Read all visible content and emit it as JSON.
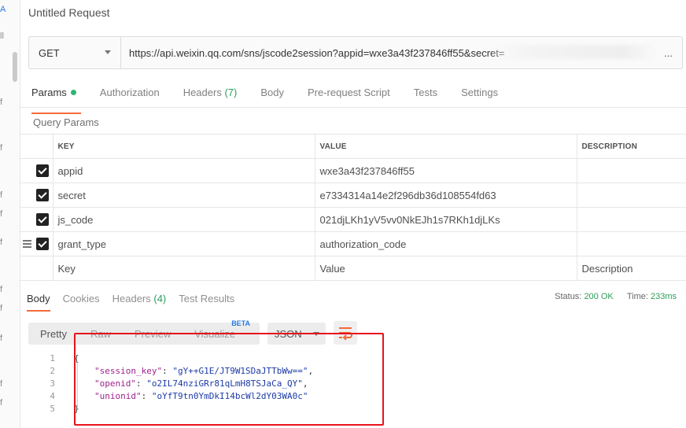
{
  "sidebar": {
    "fragments": [
      "A",
      "ll",
      "f",
      "f",
      "f",
      "f",
      "f",
      "f",
      "f",
      "f",
      "f",
      "f"
    ]
  },
  "request": {
    "title": "Untitled Request",
    "method": "GET",
    "url": "https://api.weixin.qq.com/sns/jscode2session?appid=wxe3a43f237846ff55&secret=",
    "url_overflow": "..."
  },
  "request_tabs": {
    "params": "Params",
    "authorization": "Authorization",
    "headers": "Headers",
    "headers_count": "(7)",
    "body": "Body",
    "prerequest": "Pre-request Script",
    "tests": "Tests",
    "settings": "Settings"
  },
  "query_params": {
    "label": "Query Params",
    "columns": {
      "key": "KEY",
      "value": "VALUE",
      "description": "DESCRIPTION"
    },
    "rows": [
      {
        "key": "appid",
        "value": "wxe3a43f237846ff55",
        "description": "",
        "checked": true
      },
      {
        "key": "secret",
        "value": "e7334314a14e2f296db36d108554fd63",
        "description": "",
        "checked": true
      },
      {
        "key": "js_code",
        "value": "021djLKh1yV5vv0NkEJh1s7RKh1djLKs",
        "description": "",
        "checked": true
      },
      {
        "key": "grant_type",
        "value": "authorization_code",
        "description": "",
        "checked": true
      }
    ],
    "placeholders": {
      "key": "Key",
      "value": "Value",
      "description": "Description"
    }
  },
  "response_tabs": {
    "body": "Body",
    "cookies": "Cookies",
    "headers": "Headers",
    "headers_count": "(4)",
    "test_results": "Test Results"
  },
  "status": {
    "status_label": "Status:",
    "status_value": "200 OK",
    "time_label": "Time:",
    "time_value": "233ms"
  },
  "view": {
    "pretty": "Pretty",
    "raw": "Raw",
    "preview": "Preview",
    "visualize": "Visualize",
    "beta": "BETA",
    "format": "JSON"
  },
  "response_body": {
    "line_numbers": [
      "1",
      "2",
      "3",
      "4",
      "5"
    ],
    "open_brace": "{",
    "close_brace": "}",
    "fields": [
      {
        "key": "\"session_key\"",
        "value": "\"gY++G1E/JT9W1SDaJTTbWw==\"",
        "sep": ": ",
        "end": ","
      },
      {
        "key": "\"openid\"",
        "value": "\"o2IL74nziGRr81qLmH8TSJaCa_QY\"",
        "sep": ": ",
        "end": ","
      },
      {
        "key": "\"unionid\"",
        "value": "\"oYfT9tn0YmDkI14bcWl2dY03WA0c\"",
        "sep": ": ",
        "end": ""
      }
    ]
  },
  "colors": {
    "accent": "#f26b3a",
    "ok_green": "#2b9e5c",
    "annotation_red": "#e8141b"
  }
}
